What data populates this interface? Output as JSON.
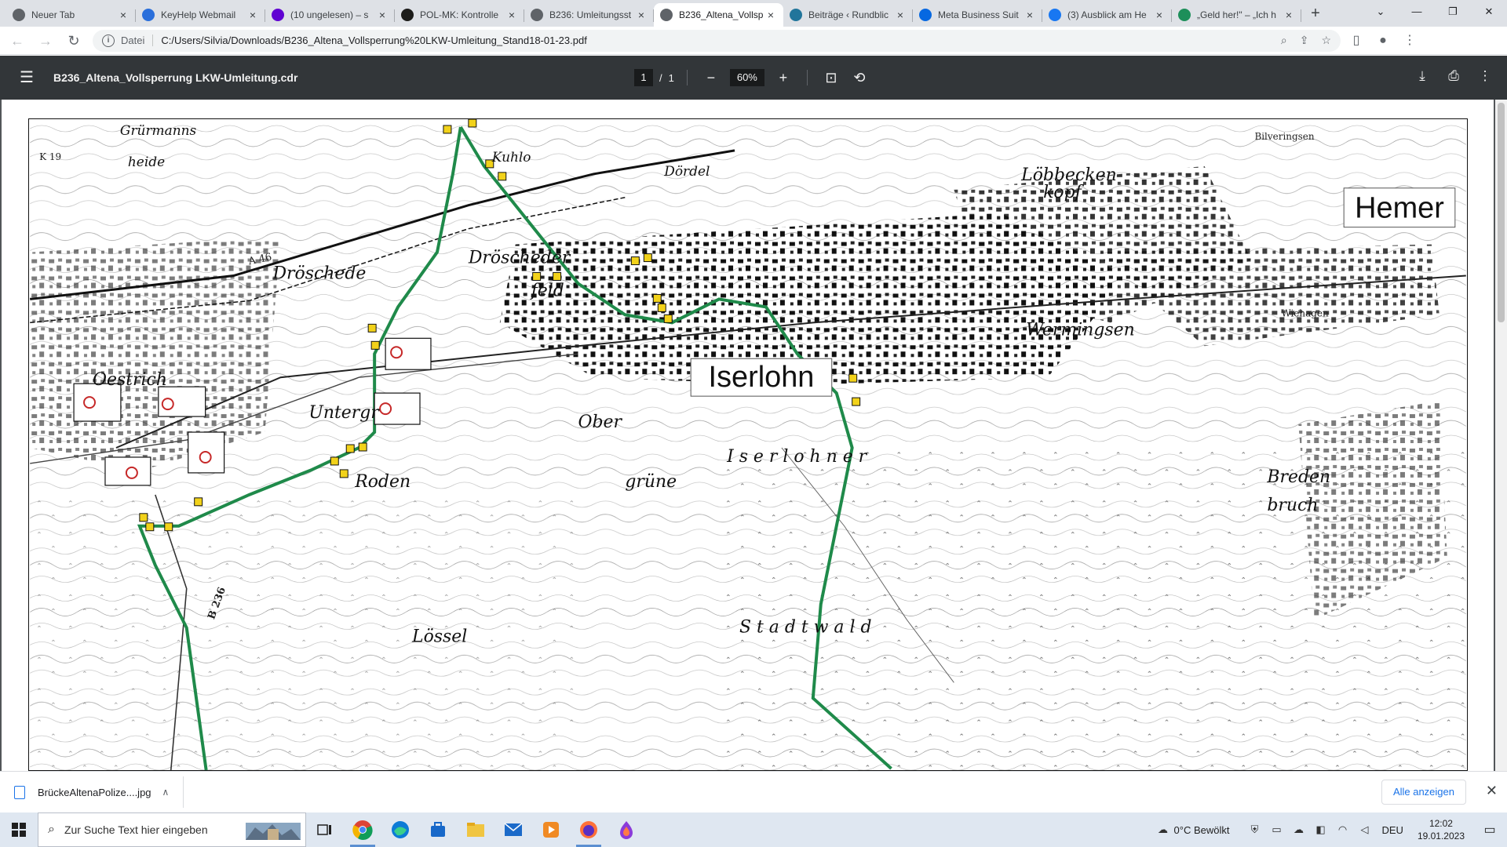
{
  "browser": {
    "tabs": [
      {
        "label": "Neuer Tab",
        "icon": "chrome-icon",
        "color": "#5f6368"
      },
      {
        "label": "KeyHelp Webmail",
        "icon": "webmail-icon",
        "color": "#2a6fdb"
      },
      {
        "label": "(10 ungelesen) – s",
        "icon": "yahoo-mail-icon",
        "color": "#6001d2"
      },
      {
        "label": "POL-MK: Kontrolle",
        "icon": "presseportal-icon",
        "color": "#1d1d1b"
      },
      {
        "label": "B236: Umleitungsst",
        "icon": "globe-icon",
        "color": "#5f6368"
      },
      {
        "label": "B236_Altena_Vollsp",
        "icon": "globe-icon",
        "color": "#5f6368",
        "active": true
      },
      {
        "label": "Beiträge ‹ Rundblic",
        "icon": "wordpress-icon",
        "color": "#21759b"
      },
      {
        "label": "Meta Business Suit",
        "icon": "meta-icon",
        "color": "#0668e1"
      },
      {
        "label": "(3) Ausblick am He",
        "icon": "facebook-icon",
        "color": "#1877f2"
      },
      {
        "label": "„Geld her!\" – „Ich h",
        "icon": "flag-icon",
        "color": "#1d8f5a"
      }
    ],
    "new_tab_symbol": "+",
    "window_controls": {
      "minimize": "—",
      "restore": "❐",
      "close": "✕"
    },
    "address": {
      "scheme_label": "Datei",
      "url": "C:/Users/Silvia/Downloads/B236_Altena_Vollsperrung%20LKW-Umleitung_Stand18-01-23.pdf"
    }
  },
  "pdf_viewer": {
    "title": "B236_Altena_Vollsperrung LKW-Umleitung.cdr",
    "current_page": "1",
    "page_separator": "/",
    "total_pages": "1",
    "zoom": "60%",
    "zoom_out": "−",
    "zoom_in": "+"
  },
  "map": {
    "labels": {
      "hemer": "Hemer",
      "iserlohn": "Iserlohn"
    },
    "places": {
      "droschede": "Dröschede",
      "oestrich": "Oestrich",
      "untergrune": "Untergr",
      "ober": "Ober",
      "grune": "grüne",
      "roden": "Roden",
      "lossel": "Lössel",
      "wermingsen": "Wermingsen",
      "lobbecken": "Löbbecken",
      "kopf": "kopf",
      "dorfel": "Dördel",
      "kuhlo": "Kuhlo",
      "feld": "feld",
      "drosch2": "Dröscheder",
      "iserlohner": "I s e r l o h n e r",
      "stadtwald": "S t a d t w a l d",
      "breden": "Breden",
      "bruch": "bruch",
      "grurmanns": "Grürmanns",
      "heide": "heide",
      "bilveringsen": "Bilveringsen",
      "wiehagen": "Wiehagen",
      "b236": "B 236",
      "a46": "A 46",
      "k19": "K 19"
    }
  },
  "downloads": {
    "file_name": "BrückeAltenaPolize....jpg",
    "show_all": "Alle anzeigen"
  },
  "taskbar": {
    "search_placeholder": "Zur Suche Text hier eingeben",
    "weather": "0°C  Bewölkt",
    "language": "DEU",
    "time": "12:02",
    "date": "19.01.2023"
  }
}
